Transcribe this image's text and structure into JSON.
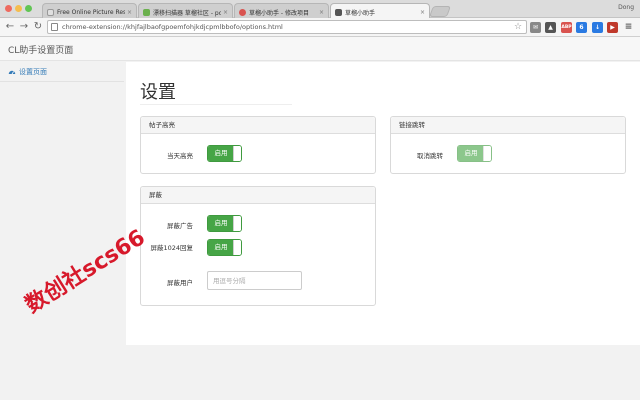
{
  "browser": {
    "tabs": [
      {
        "title": "Free Online Picture Resize",
        "close": "×",
        "favicon_color": "#e0e0e0"
      },
      {
        "title": "漂移扫描器 草榴社区 - powe",
        "close": "×",
        "favicon_color": "#6ab04c"
      },
      {
        "title": "草榴小助手 - 修改项目",
        "close": "×",
        "favicon_color": "#d9534f"
      },
      {
        "title": "草榴小助手",
        "close": "×",
        "favicon_color": "#555555"
      }
    ],
    "profile_name": "Dong",
    "url": "chrome-extension://khjfajlbaofgpoemfohjkdjcpmlbbofo/options.html",
    "extension_badges": [
      "ABP",
      "6"
    ]
  },
  "header": {
    "brand": "CL助手设置页面"
  },
  "sidebar": {
    "items": [
      {
        "label": "设置页面",
        "icon": "dashboard-icon"
      }
    ]
  },
  "main": {
    "title": "设置",
    "panels": {
      "highlight": {
        "heading": "帖子高亮",
        "rows": [
          {
            "label": "当天高亮",
            "toggle_label": "启用",
            "enabled": true
          }
        ]
      },
      "redirect": {
        "heading": "链接跳转",
        "rows": [
          {
            "label": "取消跳转",
            "toggle_label": "启用",
            "enabled": false
          }
        ]
      },
      "block": {
        "heading": "屏蔽",
        "rows": [
          {
            "label": "屏蔽广告",
            "toggle_label": "启用",
            "enabled": true
          },
          {
            "label": "屏蔽1024回复",
            "toggle_label": "启用",
            "enabled": true
          }
        ],
        "user_field": {
          "label": "屏蔽用户",
          "value": "",
          "placeholder": "用逗号分隔"
        }
      }
    }
  },
  "watermark": "数创社scs66",
  "colors": {
    "toggle_green": "#46a546",
    "link_blue": "#337ab7",
    "watermark_red": "#d7192b"
  }
}
